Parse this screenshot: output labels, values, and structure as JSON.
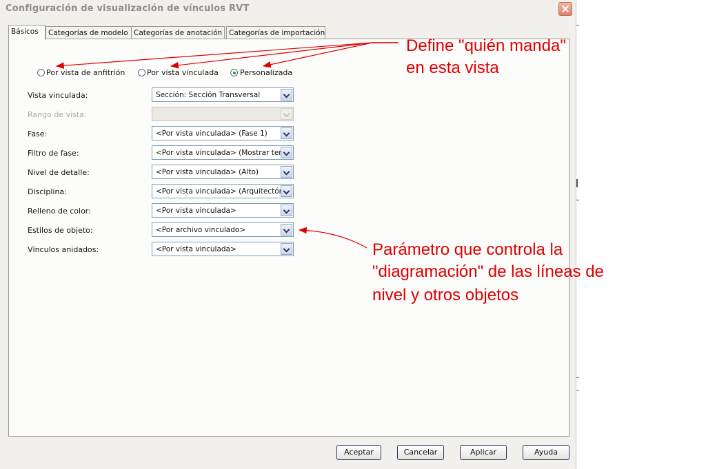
{
  "window": {
    "title": "Configuración de visualización de vínculos RVT",
    "close_icon": "close-icon"
  },
  "tabs": [
    {
      "label": "Básicos",
      "active": true
    },
    {
      "label": "Categorías de modelo",
      "active": false
    },
    {
      "label": "Categorías de anotación",
      "active": false
    },
    {
      "label": "Categorías de importación",
      "active": false
    }
  ],
  "display_mode": {
    "options": [
      {
        "label": "Por vista de anfitrión",
        "selected": false
      },
      {
        "label": "Por vista vinculada",
        "selected": false
      },
      {
        "label": "Personalizada",
        "selected": true
      }
    ]
  },
  "fields": [
    {
      "label": "Vista vinculada:",
      "value": "Sección: Sección  Transversal",
      "enabled": true
    },
    {
      "label": "Rango de vista:",
      "value": "",
      "enabled": false
    },
    {
      "label": "Fase:",
      "value": "<Por vista vinculada> (Fase 1)",
      "enabled": true
    },
    {
      "label": "Filtro de fase:",
      "value": "<Por vista vinculada> (Mostrar terminado)",
      "enabled": true
    },
    {
      "label": "Nivel de detalle:",
      "value": "<Por vista vinculada> (Alto)",
      "enabled": true
    },
    {
      "label": "Disciplina:",
      "value": "<Por vista vinculada> (Arquitectónica)",
      "enabled": true
    },
    {
      "label": "Relleno de color:",
      "value": "<Por vista vinculada>",
      "enabled": true
    },
    {
      "label": "Estilos de objeto:",
      "value": "<Por archivo vinculado>",
      "enabled": true
    },
    {
      "label": "Vínculos anidados:",
      "value": "<Por vista vinculada>",
      "enabled": true
    }
  ],
  "buttons": {
    "ok": "Aceptar",
    "cancel": "Cancelar",
    "apply": "Aplicar",
    "help": "Ayuda"
  },
  "annotations": {
    "top_line1": "Define \"quién manda\"",
    "top_line2": "en esta vista",
    "bottom_line1": "Parámetro que controla la",
    "bottom_line2": "\"diagramación\" de las líneas de",
    "bottom_line3": "nivel y otros objetos",
    "color": "#e00000"
  }
}
